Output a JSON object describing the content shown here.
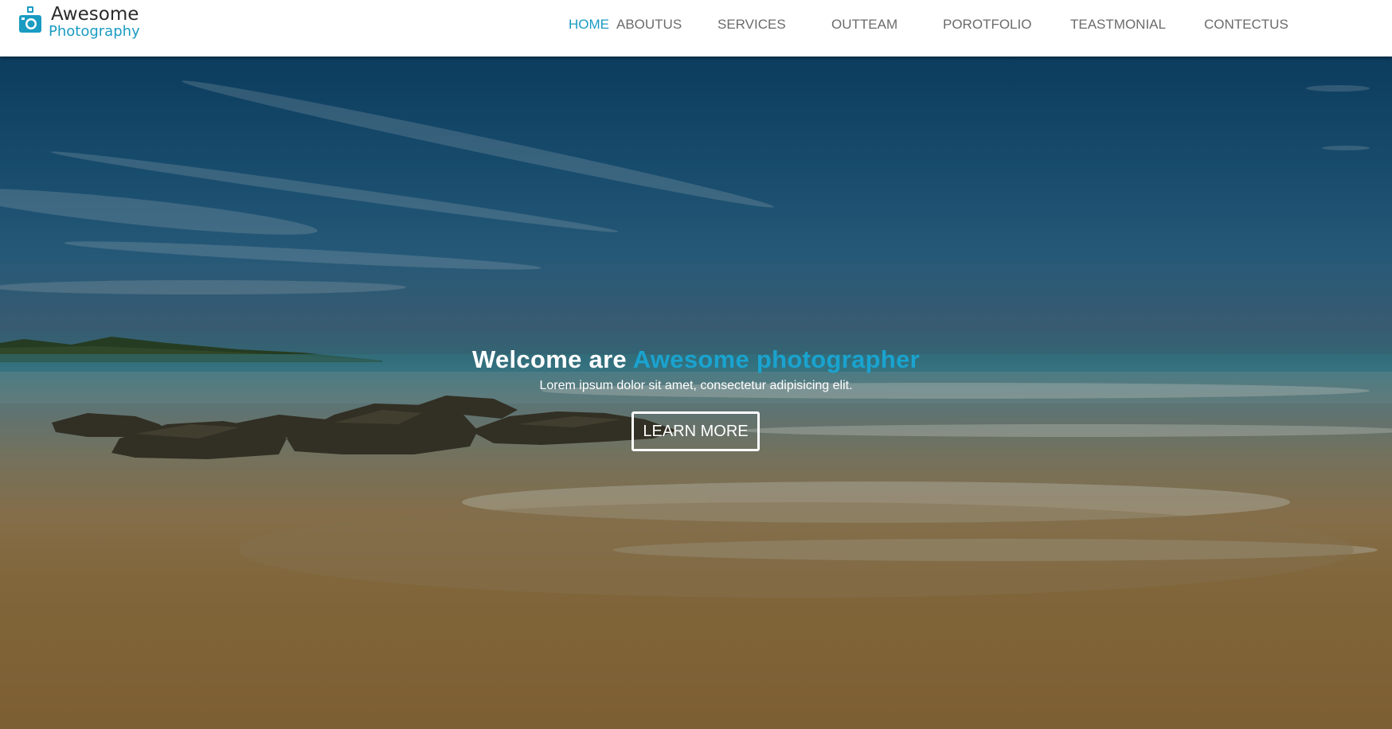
{
  "brand": {
    "line1": "Awesome",
    "line2": "Photography",
    "icon": "camera-icon",
    "accent_color": "#1a9bc2"
  },
  "nav": {
    "items": [
      {
        "label": "HOME",
        "active": true
      },
      {
        "label": "ABOUTUS",
        "active": false
      },
      {
        "label": "SERVICES",
        "active": false
      },
      {
        "label": "OUTTEAM",
        "active": false
      },
      {
        "label": "POROTFOLIO",
        "active": false
      },
      {
        "label": "TEASTMONIAL",
        "active": false
      },
      {
        "label": "CONTECTUS",
        "active": false
      }
    ],
    "active_color": "#1a9bc2",
    "inactive_color": "#6b6b6b"
  },
  "hero": {
    "title_prefix": "Welcome are",
    "title_accent": "Awesome photographer",
    "subtitle": "Lorem ipsum dolor sit amet, consectetur adipisicing elit.",
    "button_label": "LEARN MORE",
    "background": "beach-photo"
  }
}
